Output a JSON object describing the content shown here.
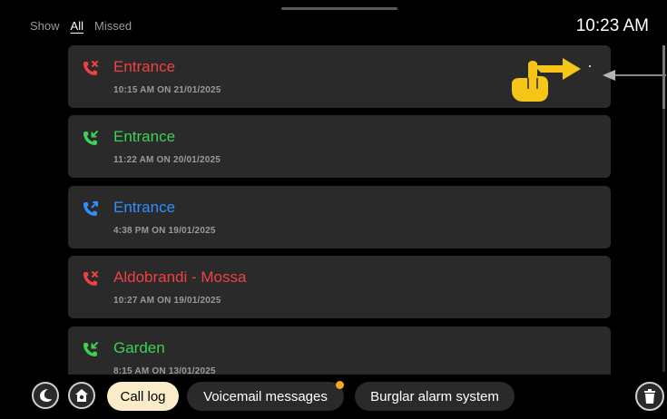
{
  "header": {
    "filter_label": "Show",
    "filter_options": [
      "All",
      "Missed"
    ],
    "active_filter": "All",
    "time": "10:23 AM"
  },
  "calls": [
    {
      "name": "Entrance",
      "time": "10:15 AM ON 21/01/2025",
      "kind": "missed",
      "color": "#f04141"
    },
    {
      "name": "Entrance",
      "time": "11:22 AM ON 20/01/2025",
      "kind": "answered",
      "color": "#3dd057"
    },
    {
      "name": "Entrance",
      "time": "4:38 PM ON 19/01/2025",
      "kind": "outgoing",
      "color": "#2f8fff"
    },
    {
      "name": "Aldobrandi - Mossa",
      "time": "10:27 AM ON 19/01/2025",
      "kind": "missed",
      "color": "#f04141"
    },
    {
      "name": "Garden",
      "time": "8:15 AM ON 13/01/2025",
      "kind": "answered",
      "color": "#3dd057"
    }
  ],
  "bottom_bar": {
    "night_icon": "moon-icon",
    "home_icon": "home-alarm-icon",
    "tabs": [
      "Call log",
      "Voicemail messages",
      "Burglar alarm system"
    ],
    "active_tab": "Call log",
    "voicemail_badge_color": "#f5a623",
    "trash_icon": "trash-icon"
  },
  "swipe_hint": {
    "icon": "swipe-hand-icon",
    "color": "#f5c518"
  }
}
